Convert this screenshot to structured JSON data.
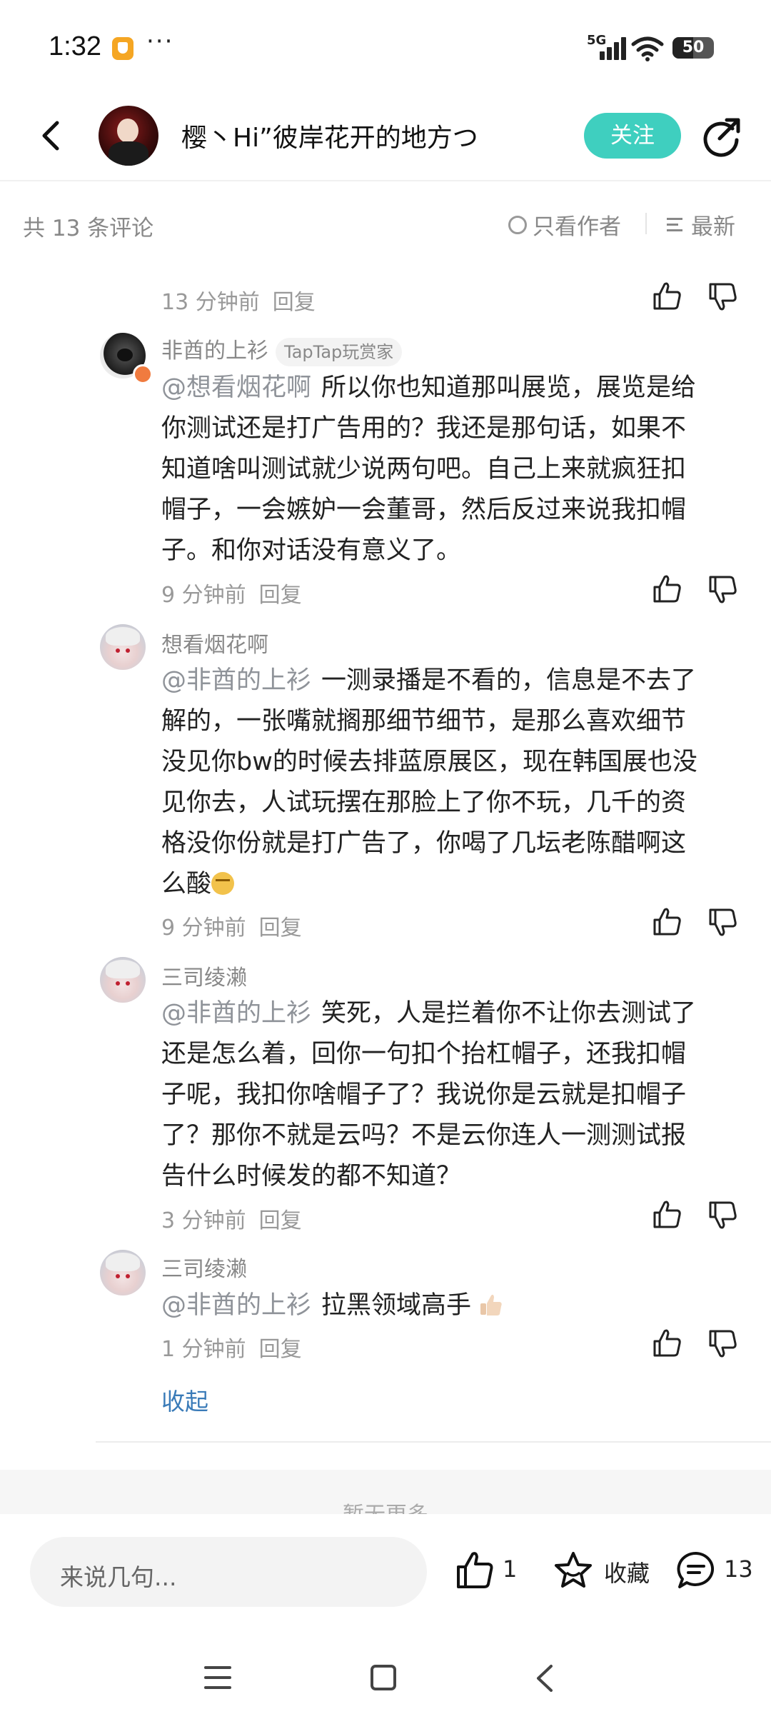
{
  "status_bar": {
    "time": "1:32",
    "more": "···",
    "network": "5G",
    "battery": "50"
  },
  "header": {
    "title": "樱丶Hi”彼岸花开的地方つ",
    "follow_label": "关注"
  },
  "filter": {
    "count": "共 13 条评论",
    "only_author": "只看作者",
    "sort": "最新"
  },
  "comments": [
    {
      "time": "13 分钟前",
      "reply": "回复"
    },
    {
      "user": "非酋的上衫",
      "badge": "TapTap玩赏家",
      "mention": "@想看烟花啊",
      "lines": [
        "所以你也知道那叫展览，展览是给",
        "你测试还是打广告用的？我还是那句话，如果不",
        "知道啥叫测试就少说两句吧。自己上来就疯狂扣",
        "帽子，一会嫉妒一会董哥，然后反过来说我扣帽",
        "子。和你对话没有意义了。"
      ],
      "time": "9 分钟前",
      "reply": "回复"
    },
    {
      "user": "想看烟花啊",
      "mention": "@非酋的上衫",
      "lines": [
        "一测录播是不看的，信息是不去了",
        "解的，一张嘴就搁那细节细节，是那么喜欢细节",
        "没见你bw的时候去排蓝原展区，现在韩国展也没",
        "见你去，人试玩摆在那脸上了你不玩，几千的资",
        "格没你份就是打广告了，你喝了几坛老陈醋啊这",
        "么酸"
      ],
      "time": "9 分钟前",
      "reply": "回复"
    },
    {
      "user": "三司绫濑",
      "mention": "@非酋的上衫",
      "lines": [
        "笑死，人是拦着你不让你去测试了",
        "还是怎么着，回你一句扣个抬杠帽子，还我扣帽",
        "子呢，我扣你啥帽子了？我说你是云就是扣帽子",
        "了？那你不就是云吗？不是云你连人一测测试报",
        "告什么时候发的都不知道？"
      ],
      "time": "3 分钟前",
      "reply": "回复"
    },
    {
      "user": "三司绫濑",
      "mention": "@非酋的上衫",
      "lines": [
        "拉黑领域高手"
      ],
      "time": "1 分钟前",
      "reply": "回复"
    }
  ],
  "collapse_label": "收起",
  "more_label": "暂无更多",
  "bottom": {
    "input_placeholder": "来说几句...",
    "like_count": "1",
    "collect_label": "收藏",
    "comment_count": "13"
  },
  "icons": {
    "back": "chevron-left-icon",
    "share": "share-icon",
    "like": "thumb-up-icon",
    "dislike": "thumb-down-icon",
    "collect": "star-icon",
    "comment": "chat-bubble-icon",
    "radio": "radio-circle-icon",
    "sort": "sort-lines-icon"
  },
  "colors": {
    "accent": "#3fcfbf",
    "link": "#3a7bb8",
    "mention": "#8f9399"
  }
}
